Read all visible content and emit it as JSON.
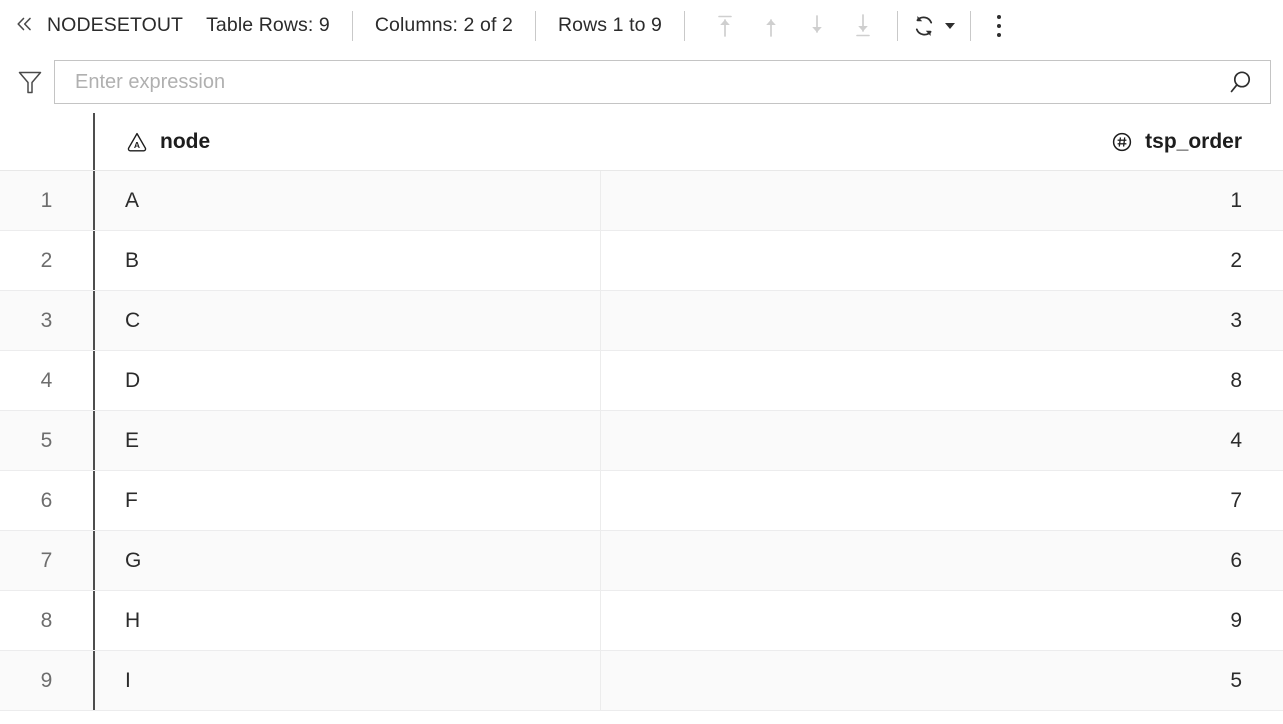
{
  "toolbar": {
    "collapse_icon": "double-chevron-left-icon",
    "table_name": "NODESETOUT",
    "row_count_label": "Table Rows: 9",
    "column_count_label": "Columns: 2 of 2",
    "row_range_label": "Rows 1 to 9",
    "nav": [
      {
        "name": "first-rows-button",
        "icon": "arrow-up-to-line-icon",
        "disabled": true
      },
      {
        "name": "previous-rows-button",
        "icon": "arrow-up-icon",
        "disabled": true
      },
      {
        "name": "next-rows-button",
        "icon": "arrow-down-icon",
        "disabled": true
      },
      {
        "name": "last-rows-button",
        "icon": "arrow-down-to-line-icon",
        "disabled": true
      }
    ],
    "refresh_icon": "refresh-icon",
    "refresh_caret_icon": "caret-down-icon",
    "overflow_icon": "kebab-menu-icon"
  },
  "filter": {
    "funnel_icon": "funnel-filter-icon",
    "expression_value": "",
    "expression_placeholder": "Enter expression",
    "search_icon": "search-icon"
  },
  "grid": {
    "columns": [
      {
        "label": "node",
        "type_icon": "string-type-icon",
        "align": "left"
      },
      {
        "label": "tsp_order",
        "type_icon": "integer-type-icon",
        "align": "right"
      }
    ],
    "rows": [
      {
        "n": "1",
        "node": "A",
        "tsp_order": "1"
      },
      {
        "n": "2",
        "node": "B",
        "tsp_order": "2"
      },
      {
        "n": "3",
        "node": "C",
        "tsp_order": "3"
      },
      {
        "n": "4",
        "node": "D",
        "tsp_order": "8"
      },
      {
        "n": "5",
        "node": "E",
        "tsp_order": "4"
      },
      {
        "n": "6",
        "node": "F",
        "tsp_order": "7"
      },
      {
        "n": "7",
        "node": "G",
        "tsp_order": "6"
      },
      {
        "n": "8",
        "node": "H",
        "tsp_order": "9"
      },
      {
        "n": "9",
        "node": "I",
        "tsp_order": "5"
      }
    ]
  },
  "colors": {
    "text": "#2b2b2b",
    "muted": "#6d6d6d",
    "placeholder": "#b0b0b0",
    "disabled_icon": "#c9c9c9",
    "row_alt": "#fafafa",
    "row_border": "#ececed",
    "gutter_divider": "#4d4d4d"
  }
}
